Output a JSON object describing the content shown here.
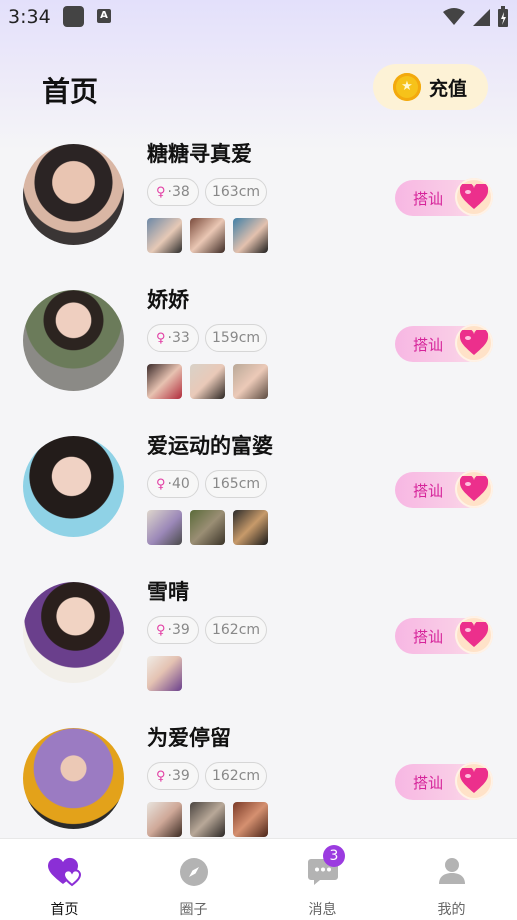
{
  "status_bar": {
    "time": "3:34",
    "a_icon_letter": "A"
  },
  "header": {
    "title": "首页",
    "recharge_label": "充值"
  },
  "users": [
    {
      "name": "糖糖寻真爱",
      "age": "38",
      "height": "163cm",
      "photo_count": 3,
      "chat_label": "搭讪"
    },
    {
      "name": "娇娇",
      "age": "33",
      "height": "159cm",
      "photo_count": 3,
      "chat_label": "搭讪"
    },
    {
      "name": "爱运动的富婆",
      "age": "40",
      "height": "165cm",
      "photo_count": 3,
      "chat_label": "搭讪"
    },
    {
      "name": "雪晴",
      "age": "39",
      "height": "162cm",
      "photo_count": 1,
      "chat_label": "搭讪"
    },
    {
      "name": "为爱停留",
      "age": "39",
      "height": "162cm",
      "photo_count": 3,
      "chat_label": "搭讪"
    }
  ],
  "nav": [
    {
      "label": "首页",
      "icon": "heart-icon",
      "active": true
    },
    {
      "label": "圈子",
      "icon": "compass-icon",
      "active": false
    },
    {
      "label": "消息",
      "icon": "chat-icon",
      "active": false,
      "badge": "3"
    },
    {
      "label": "我的",
      "icon": "profile-icon",
      "active": false
    }
  ],
  "colors": {
    "accent": "#9b3be0",
    "chat_pink": "#d6249a",
    "gender_pink": "#e23fa4"
  }
}
